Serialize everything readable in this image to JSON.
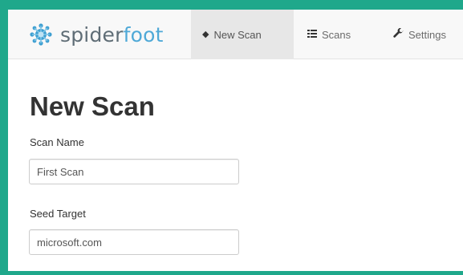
{
  "app": {
    "brand_prefix": "spider",
    "brand_suffix": "foot",
    "brand_color": "#4fa9d7",
    "frame_color": "#1fa88b"
  },
  "navbar": {
    "items": [
      {
        "label": "New Scan",
        "icon": "diamond-icon",
        "active": true
      },
      {
        "label": "Scans",
        "icon": "list-icon",
        "active": false
      },
      {
        "label": "Settings",
        "icon": "wrench-icon",
        "active": false
      }
    ]
  },
  "page": {
    "title": "New Scan"
  },
  "form": {
    "scan_name": {
      "label": "Scan Name",
      "value": "First Scan"
    },
    "seed_target": {
      "label": "Seed Target",
      "value": "microsoft.com"
    }
  }
}
